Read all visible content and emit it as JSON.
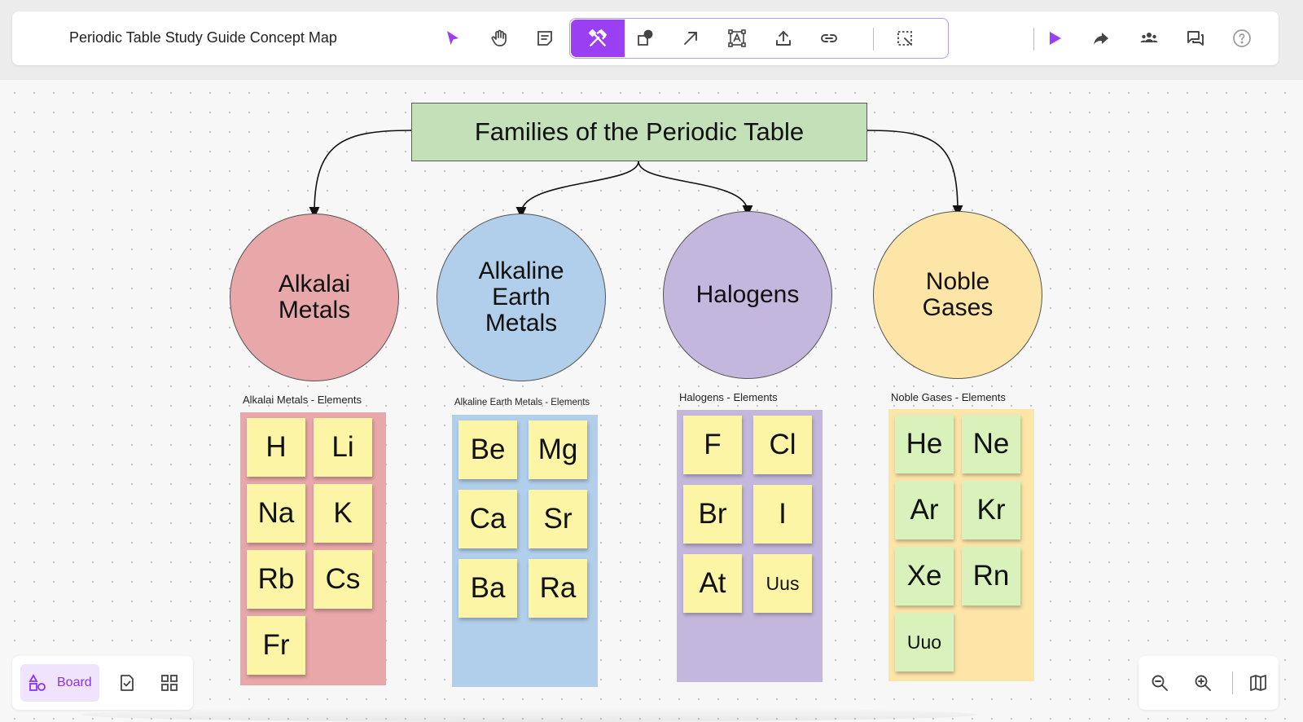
{
  "header": {
    "doc_title": "Periodic Table Study Guide Concept Map"
  },
  "toolbar": {
    "tools": [
      "select-icon",
      "hand-icon",
      "sticky-note-icon",
      "tools-icon",
      "shapes-icon",
      "arrow-icon",
      "text-icon",
      "upload-icon",
      "link-icon",
      "select-area-icon"
    ],
    "active_tool": "tools-icon",
    "accent": "#9a3ff2",
    "right": [
      "present-icon",
      "share-icon",
      "collaborators-icon",
      "comments-icon",
      "help-icon"
    ]
  },
  "board": {
    "title": "Families of the Periodic Table",
    "families": [
      {
        "name": "Alkalai Metals",
        "color": "#e8a7a9",
        "elements_label": "Alkalai Metals - Elements",
        "box_color": "#e8a7a9",
        "elements": [
          "H",
          "Li",
          "Na",
          "K",
          "Rb",
          "Cs",
          "Fr"
        ]
      },
      {
        "name": "Alkaline Earth Metals",
        "color": "#b1cfea",
        "elements_label": "Alkaline Earth Metals - Elements",
        "box_color": "#b1cfea",
        "elements": [
          "Be",
          "Mg",
          "Ca",
          "Sr",
          "Ba",
          "Ra"
        ]
      },
      {
        "name": "Halogens",
        "color": "#c3b7dd",
        "elements_label": "Halogens - Elements",
        "box_color": "#c3b7dd",
        "elements": [
          "F",
          "Cl",
          "Br",
          "I",
          "At",
          "Uus"
        ]
      },
      {
        "name": "Noble Gases",
        "color": "#fde5a8",
        "elements_label": "Noble Gases - Elements",
        "box_color": "#fde5a8",
        "elements": [
          "He",
          "Ne",
          "Ar",
          "Kr",
          "Xe",
          "Rn",
          "Uuo"
        ]
      }
    ],
    "sticky_colors": {
      "yellow": "#fdf5a6",
      "green": "#d9f2bb"
    }
  },
  "bottom_bar": {
    "board_label": "Board"
  }
}
